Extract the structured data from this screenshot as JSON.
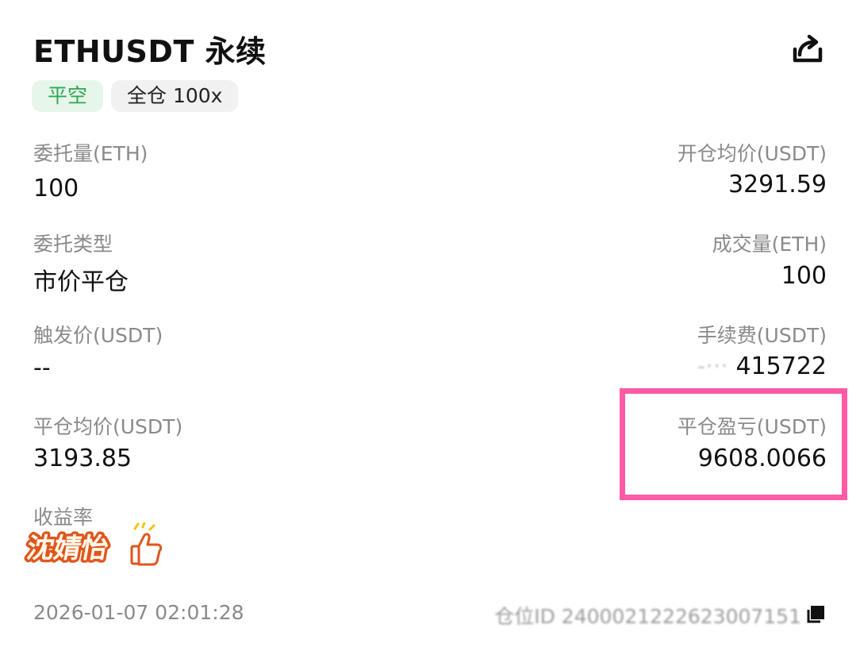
{
  "header": {
    "title": "ETHUSDT 永续",
    "share_icon": "share-icon"
  },
  "tags": {
    "side": "平空",
    "margin_mode": "全仓 100x"
  },
  "fields": {
    "order_qty_label": "委托量(ETH)",
    "order_qty_value": "100",
    "open_avg_price_label": "开仓均价(USDT)",
    "open_avg_price_value": "3291.59",
    "order_type_label": "委托类型",
    "order_type_value": "市价平仓",
    "filled_qty_label": "成交量(ETH)",
    "filled_qty_value": "100",
    "trigger_price_label": "触发价(USDT)",
    "trigger_price_value": "--",
    "fee_label": "手续费(USDT)",
    "fee_value": "415722",
    "close_avg_price_label": "平仓均价(USDT)",
    "close_avg_price_value": "3193.85",
    "close_pnl_label": "平仓盈亏(USDT)",
    "close_pnl_value": "9608.0066",
    "roi_label": "收益率"
  },
  "sticker": {
    "text": "沈婧怡",
    "icon": "thumbs-up-icon"
  },
  "footer": {
    "timestamp": "2026-01-07 02:01:28",
    "position_id": "仓位ID 2400021222623007151",
    "copy_icon": "copy-icon"
  },
  "colors": {
    "side_green": "#2ea84f",
    "highlight_pink": "#ff5aa5",
    "label_gray": "#8a8a8a"
  }
}
